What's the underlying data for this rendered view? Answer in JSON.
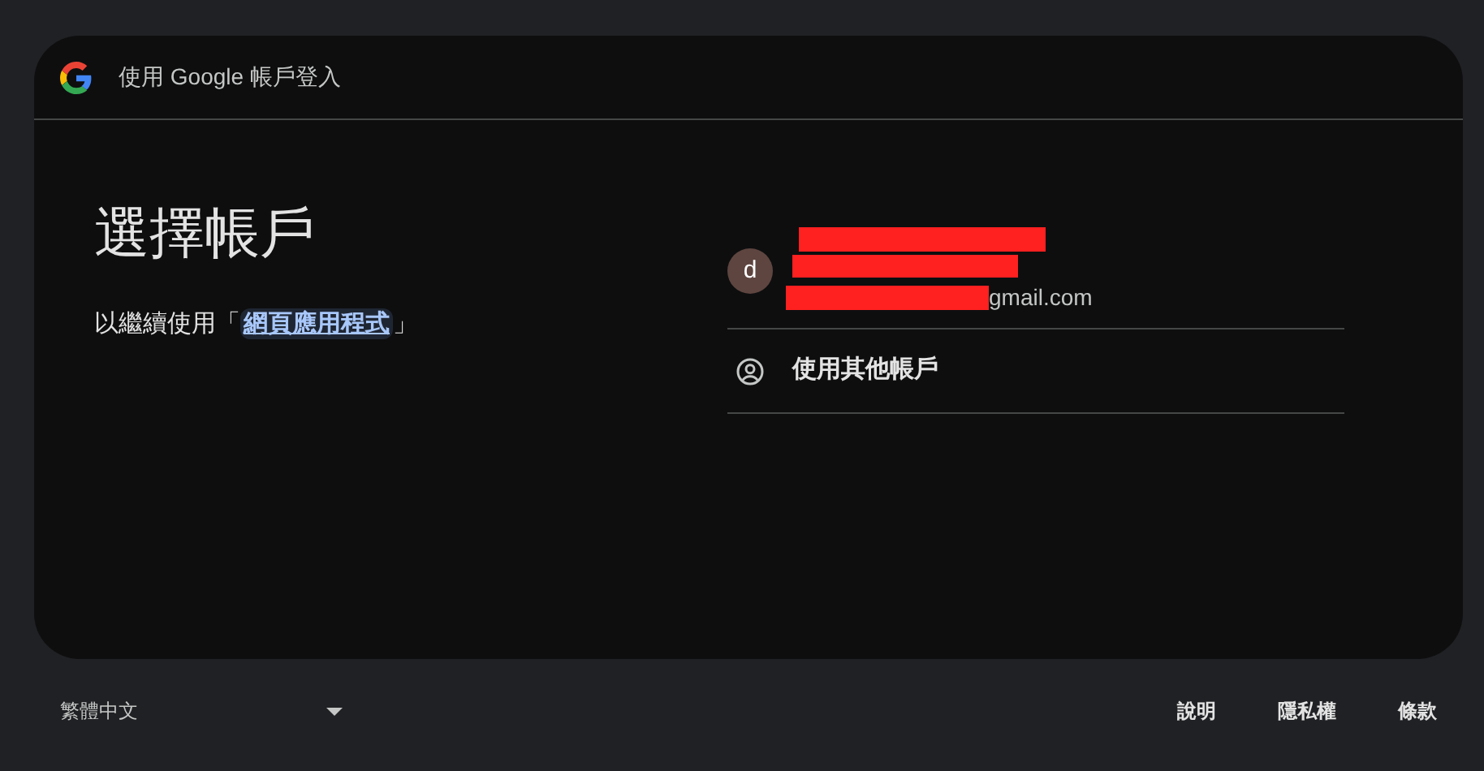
{
  "header": {
    "title": "使用 Google 帳戶登入"
  },
  "heading": "選擇帳戶",
  "subtitle": {
    "before": "以繼續使用「",
    "link": "網頁應用程式",
    "after": "」"
  },
  "account": {
    "avatar": "d",
    "email": "gmail.com",
    "redacted": true
  },
  "other_account": {
    "label": "使用其他帳戶"
  },
  "footer": {
    "language": "繁體中文",
    "links": [
      "說明",
      "隱私權",
      "條款"
    ]
  }
}
